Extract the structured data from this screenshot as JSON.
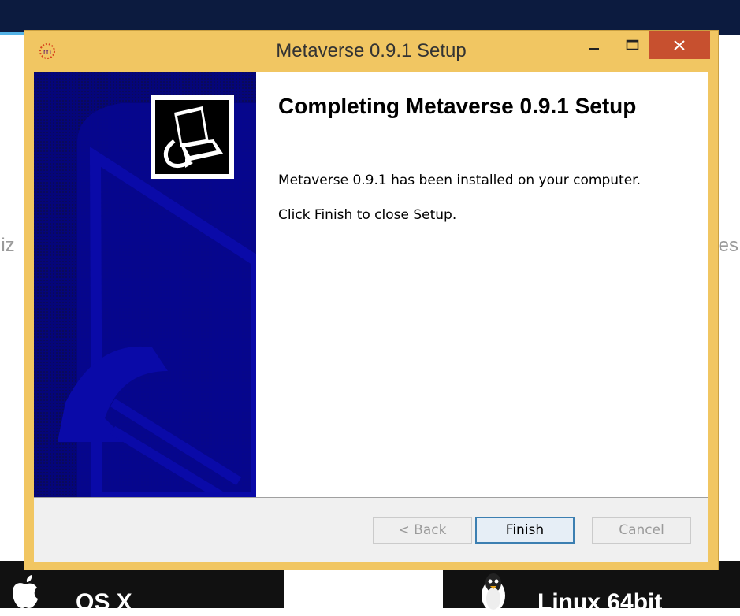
{
  "background_page": {
    "text_left": "liz",
    "text_right": "es",
    "downloads": [
      {
        "label": "OS X",
        "icon": "apple-icon"
      },
      {
        "label": "Linux 64bit",
        "icon": "tux-penguin-icon"
      }
    ]
  },
  "window": {
    "title": "Metaverse 0.9.1 Setup",
    "app_icon": "metaverse-logo-icon",
    "controls": {
      "minimize": "minimize-icon",
      "maximize": "maximize-icon",
      "close": "close-icon"
    },
    "frame_color": "#f1c662",
    "close_color": "#c7502f"
  },
  "wizard": {
    "banner_color": "#05057a",
    "banner_icon": "computer-install-icon",
    "heading": "Completing Metaverse 0.9.1 Setup",
    "message_installed": "Metaverse 0.9.1 has been installed on your computer.",
    "message_finish": "Click Finish to close Setup."
  },
  "buttons": {
    "back": "< Back",
    "finish": "Finish",
    "cancel": "Cancel"
  }
}
